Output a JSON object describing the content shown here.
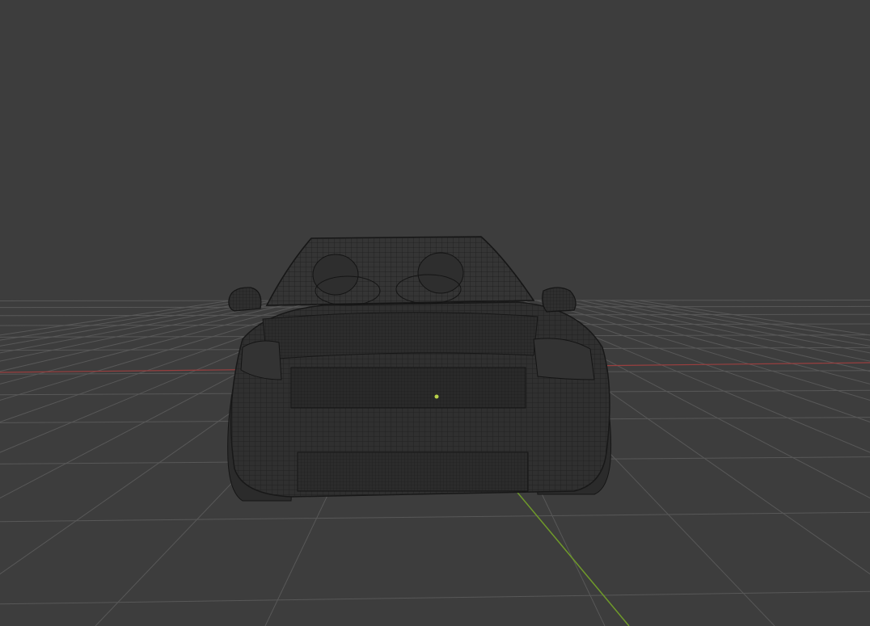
{
  "viewport": {
    "mode": "wireframe",
    "background_color": "#3d3d3d",
    "grid_line_color": "#585858",
    "x_axis_color": "#9a3f3f",
    "y_axis_color": "#6f9a2a",
    "object_shade_color": "#303030",
    "wire_color": "#181818",
    "object_icon": "car-wireframe-icon"
  }
}
